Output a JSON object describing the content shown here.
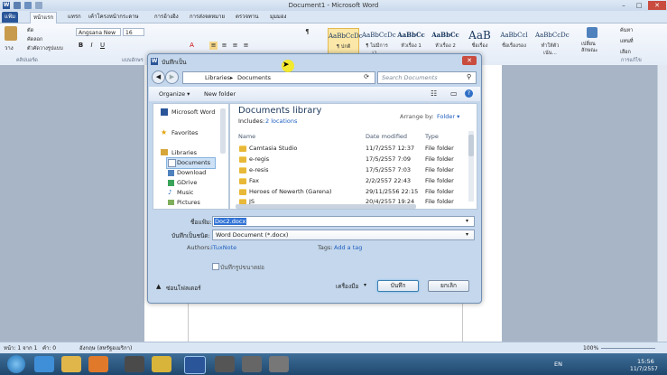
{
  "window": {
    "title": "Document1 - Microsoft Word",
    "minimize": "–",
    "maximize": "□",
    "close": "✕"
  },
  "ribbon_tabs": [
    "แฟ้ม",
    "หน้าแรก",
    "แทรก",
    "เค้าโครงหน้ากระดาษ",
    "การอ้างอิง",
    "การส่งจดหมาย",
    "ตรวจทาน",
    "มุมมอง"
  ],
  "ribbon": {
    "paste_label": "วาง",
    "cut": "ตัด",
    "copy": "คัดลอก",
    "format_painter": "ตัวคัดวางรูปแบบ",
    "clipboard_group": "คลิปบอร์ด",
    "font_name": "Angsana New",
    "font_size": "16",
    "font_group": "แบบอักษร",
    "styles": [
      {
        "sample": "AaBbCcDc",
        "name": "¶ ปกติ"
      },
      {
        "sample": "AaBbCcDc",
        "name": "¶ ไม่มีการเว..."
      },
      {
        "sample": "AaBbCc",
        "name": "หัวเรื่อง 1"
      },
      {
        "sample": "AaBbCc",
        "name": "หัวเรื่อง 2"
      },
      {
        "sample": "AaB",
        "name": "ชื่อเรื่อง"
      },
      {
        "sample": "AaBbCcl",
        "name": "ชื่อเรื่องรอง"
      },
      {
        "sample": "AaBbCcDc",
        "name": "ทำให้ตัวเน้น..."
      }
    ],
    "change_styles": "เปลี่ยน\nลักษณะ",
    "find": "ค้นหา",
    "replace": "แทนที่",
    "select": "เลือก",
    "editing_group": "การแก้ไข"
  },
  "status": {
    "page": "หน้า: 1 จาก 1",
    "words": "คำ: 0",
    "language": "อังกฤษ (สหรัฐอเมริกา)",
    "zoom": "100%"
  },
  "taskbar": {
    "lang": "EN",
    "time": "15:56",
    "date": "11/7/2557"
  },
  "dialog": {
    "title": "บันทึกเป็น",
    "breadcrumb": [
      "Libraries",
      "Documents"
    ],
    "search_placeholder": "Search Documents",
    "organize": "Organize ▾",
    "new_folder": "New folder",
    "nav": {
      "word": "Microsoft Word",
      "favorites": "Favorites",
      "libraries": "Libraries",
      "documents": "Documents",
      "download": "Download",
      "gdrive": "GDrive",
      "music": "Music",
      "pictures": "Pictures"
    },
    "library_title": "Documents library",
    "includes_prefix": "Includes:",
    "includes_link": "2 locations",
    "arrange_by": "Arrange by:",
    "arrange_value": "Folder ▾",
    "columns": [
      "Name",
      "Date modified",
      "Type"
    ],
    "files": [
      {
        "name": "Camtasia Studio",
        "date": "11/7/2557 12:37",
        "type": "File folder"
      },
      {
        "name": "e-regis",
        "date": "17/5/2557 7:09",
        "type": "File folder"
      },
      {
        "name": "e-resis",
        "date": "17/5/2557 7:03",
        "type": "File folder"
      },
      {
        "name": "Fax",
        "date": "2/2/2557 22:43",
        "type": "File folder"
      },
      {
        "name": "Heroes of Newerth (Garena)",
        "date": "29/11/2556 22:15",
        "type": "File folder"
      },
      {
        "name": "JS",
        "date": "20/4/2557 19:24",
        "type": "File folder"
      }
    ],
    "filename_label": "ชื่อแฟ้ม:",
    "filename_value": "Doc2.docx",
    "savetype_label": "บันทึกเป็นชนิด:",
    "savetype_value": "Word Document (*.docx)",
    "authors_label": "Authors:",
    "authors_value": "iTuxNote",
    "tags_label": "Tags:",
    "tags_value": "Add a tag",
    "thumbnail_label": "บันทึกรูปขนาดย่อ",
    "hide_folders": "ซ่อนโฟลเดอร์",
    "tools": "เครื่องมือ",
    "save": "บันทึก",
    "cancel": "ยกเลิก"
  }
}
